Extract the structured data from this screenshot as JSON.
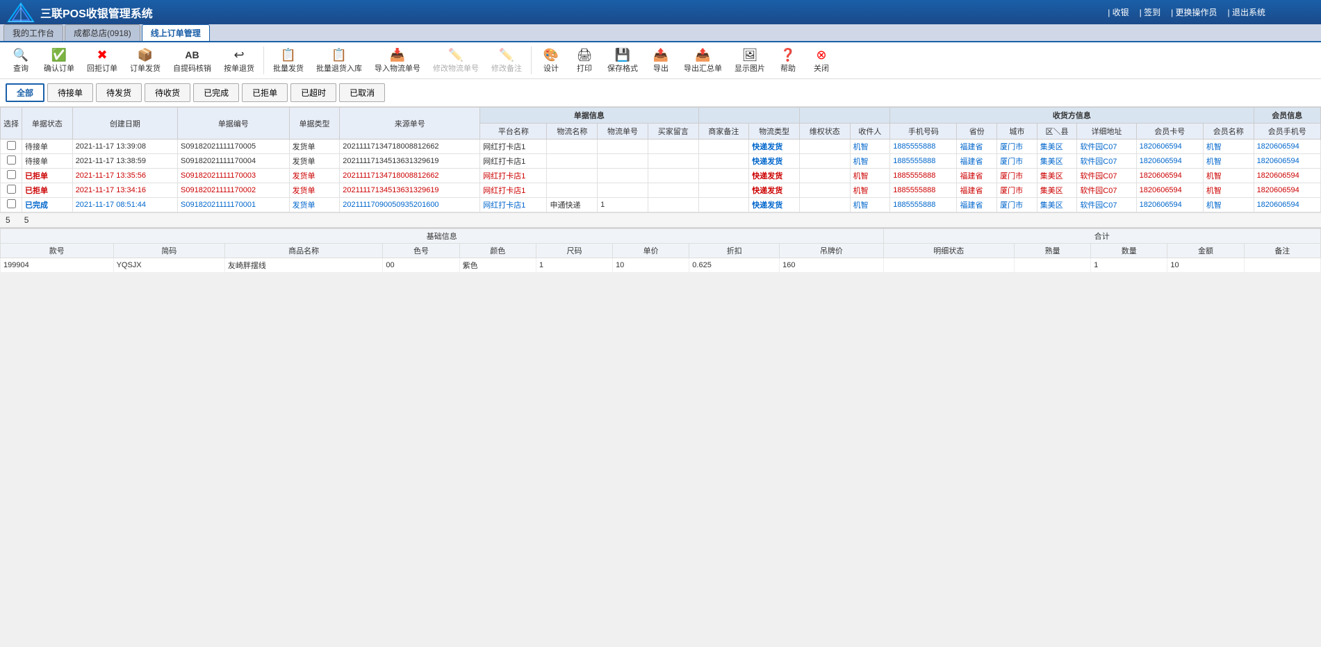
{
  "app": {
    "title": "三联POS收银管理系统",
    "logo_icon": "🔷"
  },
  "top_menu": {
    "items": [
      {
        "label": "| 收银",
        "id": "shoyin"
      },
      {
        "label": "| 签到",
        "id": "qiandao"
      },
      {
        "label": "| 更换操作员",
        "id": "change_op"
      },
      {
        "label": "| 退出系统",
        "id": "exit"
      }
    ]
  },
  "tabs": [
    {
      "label": "我的工作台",
      "id": "work",
      "active": false
    },
    {
      "label": "成都总店(0918)",
      "id": "chengdu",
      "active": false
    },
    {
      "label": "线上订单管理",
      "id": "online_order",
      "active": true
    }
  ],
  "toolbar": {
    "buttons": [
      {
        "id": "query",
        "icon": "✔",
        "label": "查询",
        "disabled": false
      },
      {
        "id": "confirm",
        "icon": "✔",
        "label": "确认订单",
        "disabled": false
      },
      {
        "id": "reject",
        "icon": "✖",
        "label": "回拒订单",
        "disabled": false
      },
      {
        "id": "send",
        "icon": "📦",
        "label": "订单发货",
        "disabled": false
      },
      {
        "id": "self_pickup",
        "icon": "AB",
        "label": "自提码核销",
        "disabled": false
      },
      {
        "id": "return",
        "icon": "↩",
        "label": "按单退货",
        "disabled": false
      },
      {
        "id": "batch_send",
        "icon": "📋",
        "label": "批量发货",
        "disabled": false
      },
      {
        "id": "batch_return",
        "icon": "📋",
        "label": "批量退货入库",
        "disabled": false
      },
      {
        "id": "import_logistics",
        "icon": "📥",
        "label": "导入物流单号",
        "disabled": false
      },
      {
        "id": "edit_logistics",
        "icon": "✏️",
        "label": "修改物流单号",
        "disabled": false
      },
      {
        "id": "edit_note",
        "icon": "✏️",
        "label": "修改备注",
        "disabled": false
      },
      {
        "id": "design",
        "icon": "🎨",
        "label": "设计",
        "disabled": false
      },
      {
        "id": "print",
        "icon": "🖨",
        "label": "打印",
        "disabled": false
      },
      {
        "id": "save_format",
        "icon": "💾",
        "label": "保存格式",
        "disabled": false
      },
      {
        "id": "export",
        "icon": "📤",
        "label": "导出",
        "disabled": false
      },
      {
        "id": "export_merge",
        "icon": "📤",
        "label": "导出汇总单",
        "disabled": false
      },
      {
        "id": "show_image",
        "icon": "🖼",
        "label": "显示图片",
        "disabled": false
      },
      {
        "id": "help",
        "icon": "❓",
        "label": "帮助",
        "disabled": false
      },
      {
        "id": "close",
        "icon": "⊗",
        "label": "关闭",
        "disabled": false
      }
    ]
  },
  "filter_buttons": [
    {
      "label": "全部",
      "id": "all",
      "active": true
    },
    {
      "label": "待接单",
      "id": "waiting",
      "active": false
    },
    {
      "label": "待发货",
      "id": "to_send",
      "active": false
    },
    {
      "label": "待收货",
      "id": "to_receive",
      "active": false
    },
    {
      "label": "已完成",
      "id": "completed",
      "active": false
    },
    {
      "label": "已拒单",
      "id": "rejected",
      "active": false
    },
    {
      "label": "已超时",
      "id": "overtime",
      "active": false
    },
    {
      "label": "已取消",
      "id": "cancelled",
      "active": false
    }
  ],
  "table": {
    "group_headers": [
      {
        "label": "单据信息",
        "colspan": 8
      },
      {
        "label": "收货方信息",
        "colspan": 7
      },
      {
        "label": "会员信息",
        "colspan": 4
      }
    ],
    "columns": [
      "选择",
      "单据状态",
      "创建日期",
      "单据编号",
      "单据类型",
      "来源单号",
      "平台名称",
      "物流名称",
      "物流单号",
      "买家留言",
      "商家备注",
      "物流类型",
      "维权状态",
      "收件人",
      "手机号码",
      "省份",
      "城市",
      "区\\县",
      "详细地址",
      "会员卡号",
      "会员名称",
      "会员手机号"
    ],
    "rows": [
      {
        "status_class": "status-waiting",
        "status": "待接单",
        "date": "2021-11-17 13:39:08",
        "order_no": "S09182021111170005",
        "type": "发货单",
        "source_no": "20211117134718008812662",
        "platform": "网红打卡店1",
        "logistics_name": "",
        "logistics_no": "",
        "buyer_note": "",
        "merchant_note": "",
        "logistics_type": "快递发货",
        "rights_status": "",
        "receiver": "机智",
        "phone": "1885555888",
        "province": "福建省",
        "city": "厦门市",
        "district": "集美区",
        "address": "软件园C07",
        "member_card": "1820606594",
        "member_name": "机智",
        "member_phone": "1820606594",
        "row_class": "row-waiting",
        "logistics_class": "logistics-fast-blue"
      },
      {
        "status_class": "status-waiting",
        "status": "待接单",
        "date": "2021-11-17 13:38:59",
        "order_no": "S09182021111170004",
        "type": "发货单",
        "source_no": "20211117134513631329619",
        "platform": "网红打卡店1",
        "logistics_name": "",
        "logistics_no": "",
        "buyer_note": "",
        "merchant_note": "",
        "logistics_type": "快递发货",
        "rights_status": "",
        "receiver": "机智",
        "phone": "1885555888",
        "province": "福建省",
        "city": "厦门市",
        "district": "集美区",
        "address": "软件园C07",
        "member_card": "1820606594",
        "member_name": "机智",
        "member_phone": "1820606594",
        "row_class": "row-waiting",
        "logistics_class": "logistics-fast-blue"
      },
      {
        "status_class": "status-rejected",
        "status": "已拒单",
        "date": "2021-11-17 13:35:56",
        "order_no": "S09182021111170003",
        "type": "发货单",
        "source_no": "20211117134718008812662",
        "platform": "网红打卡店1",
        "logistics_name": "",
        "logistics_no": "",
        "buyer_note": "",
        "merchant_note": "",
        "logistics_type": "快递发货",
        "rights_status": "",
        "receiver": "机智",
        "phone": "1885555888",
        "province": "福建省",
        "city": "厦门市",
        "district": "集美区",
        "address": "软件园C07",
        "member_card": "1820606594",
        "member_name": "机智",
        "member_phone": "1820606594",
        "row_class": "row-rejected",
        "logistics_class": "logistics-fast"
      },
      {
        "status_class": "status-rejected",
        "status": "已拒单",
        "date": "2021-11-17 13:34:16",
        "order_no": "S09182021111170002",
        "type": "发货单",
        "source_no": "20211117134513631329619",
        "platform": "网红打卡店1",
        "logistics_name": "",
        "logistics_no": "",
        "buyer_note": "",
        "merchant_note": "",
        "logistics_type": "快递发货",
        "rights_status": "",
        "receiver": "机智",
        "phone": "1885555888",
        "province": "福建省",
        "city": "厦门市",
        "district": "集美区",
        "address": "软件园C07",
        "member_card": "1820606594",
        "member_name": "机智",
        "member_phone": "1820606594",
        "row_class": "row-rejected",
        "logistics_class": "logistics-fast"
      },
      {
        "status_class": "status-completed",
        "status": "已完成",
        "date": "2021-11-17 08:51:44",
        "order_no": "S09182021111170001",
        "type": "发货单",
        "source_no": "20211117090050935201600",
        "platform": "网红打卡店1",
        "logistics_name": "申通快递",
        "logistics_no": "1",
        "buyer_note": "",
        "merchant_note": "",
        "logistics_type": "快递发货",
        "rights_status": "",
        "receiver": "机智",
        "phone": "1885555888",
        "province": "福建省",
        "city": "厦门市",
        "district": "集美区",
        "address": "软件园C07",
        "member_card": "1820606594",
        "member_name": "机智",
        "member_phone": "1820606594",
        "row_class": "row-completed",
        "logistics_class": "logistics-fast-blue"
      }
    ]
  },
  "pager": {
    "total_count": "5",
    "page_count": "5"
  },
  "detail": {
    "group_headers": [
      {
        "label": "基础信息",
        "colspan": 4
      },
      {
        "label": "合计",
        "colspan": 6
      }
    ],
    "columns": [
      "款号",
      "简码",
      "商品名称",
      "色号",
      "颜色",
      "尺码",
      "单价",
      "折扣",
      "吊牌价",
      "明细状态",
      "熟量",
      "数量",
      "金额",
      "备注"
    ],
    "rows": [
      {
        "style_no": "199904",
        "code": "YQSJX",
        "name": "友崎胖摆线",
        "color_code": "00",
        "color": "紫色",
        "size": "1",
        "price": "10",
        "discount": "0.625",
        "tag_price": "160",
        "detail_status": "",
        "qty_box": "",
        "qty": "1",
        "amount": "10",
        "note": ""
      }
    ]
  }
}
